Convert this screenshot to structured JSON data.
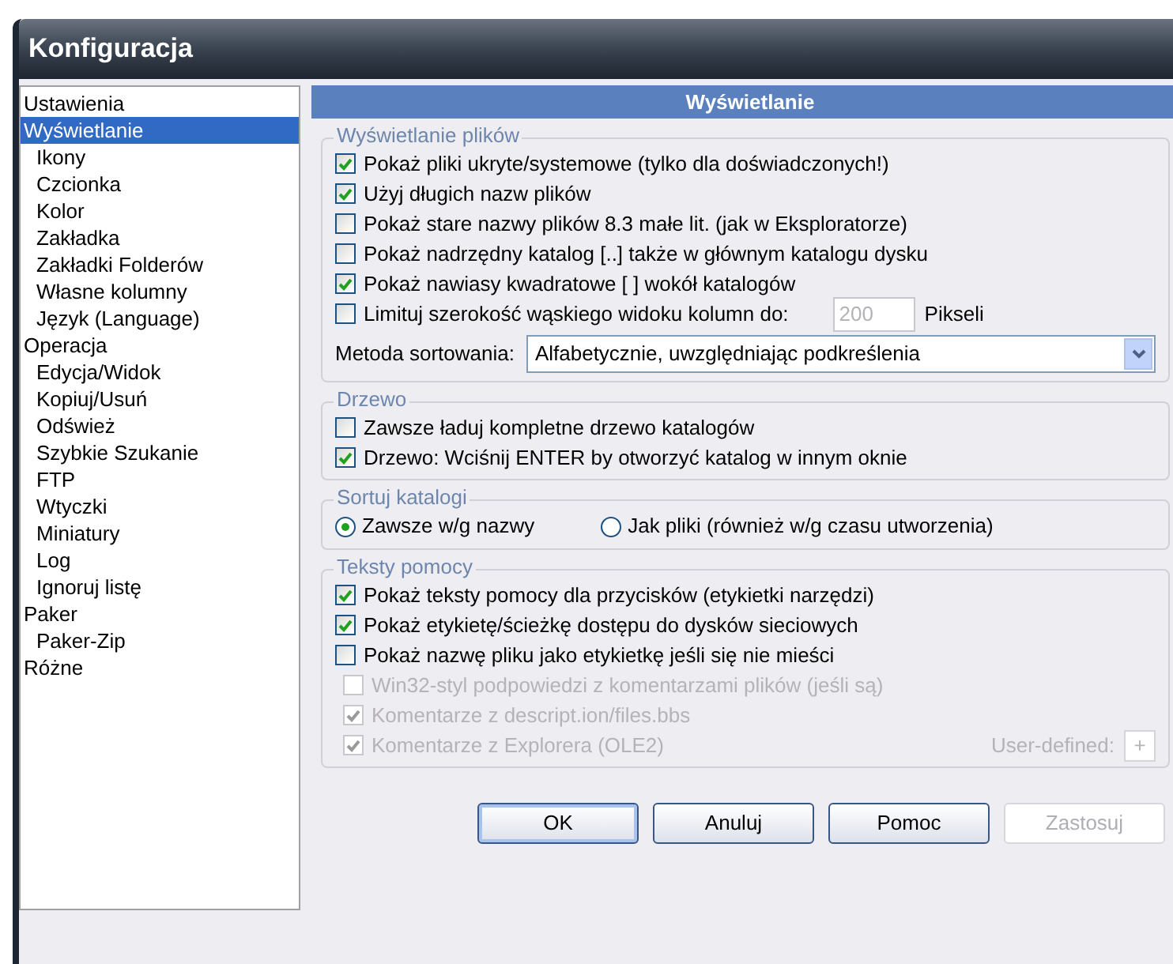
{
  "window": {
    "title": "Konfiguracja"
  },
  "sidebar": {
    "items": [
      {
        "label": "Ustawienia",
        "selected": false
      },
      {
        "label": "Wyświetlanie",
        "selected": true,
        "children": [
          {
            "label": "Ikony",
            "selected": false
          },
          {
            "label": "Czcionka",
            "selected": false
          },
          {
            "label": "Kolor",
            "selected": false
          },
          {
            "label": "Zakładka",
            "selected": false
          },
          {
            "label": "Zakładki Folderów",
            "selected": false
          },
          {
            "label": "Własne kolumny",
            "selected": false
          },
          {
            "label": "Język (Language)",
            "selected": false
          }
        ]
      },
      {
        "label": "Operacja",
        "selected": false,
        "children": [
          {
            "label": "Edycja/Widok",
            "selected": false
          },
          {
            "label": "Kopiuj/Usuń",
            "selected": false
          },
          {
            "label": "Odśwież",
            "selected": false
          },
          {
            "label": "Szybkie Szukanie",
            "selected": false
          },
          {
            "label": "FTP",
            "selected": false
          },
          {
            "label": "Wtyczki",
            "selected": false
          },
          {
            "label": "Miniatury",
            "selected": false
          },
          {
            "label": "Log",
            "selected": false
          },
          {
            "label": "Ignoruj listę",
            "selected": false
          }
        ]
      },
      {
        "label": "Paker",
        "selected": false,
        "children": [
          {
            "label": "Paker-Zip",
            "selected": false
          }
        ]
      },
      {
        "label": "Różne",
        "selected": false
      }
    ]
  },
  "panel_title": "Wyświetlanie",
  "groups": [
    {
      "title": "Wyświetlanie plików",
      "rows": [
        {
          "kind": "checkbox",
          "label": "Pokaż pliki ukryte/systemowe (tylko dla doświadczonych!)",
          "checked": true,
          "disabled": false
        },
        {
          "kind": "checkbox",
          "label": "Użyj długich nazw plików",
          "checked": true,
          "disabled": false
        },
        {
          "kind": "checkbox",
          "label": "Pokaż stare nazwy plików 8.3 małe lit. (jak w Eksploratorze)",
          "checked": false,
          "disabled": false
        },
        {
          "kind": "checkbox",
          "label": "Pokaż nadrzędny katalog [..] także w głównym katalogu dysku",
          "checked": false,
          "disabled": false
        },
        {
          "kind": "checkbox",
          "label": "Pokaż nawiasy kwadratowe [ ] wokół katalogów",
          "checked": true,
          "disabled": false
        },
        {
          "kind": "checkbox_input",
          "label": "Limituj szerokość wąskiego widoku kolumn do:",
          "checked": false,
          "disabled": false,
          "value": "200",
          "unit": "Pikseli"
        },
        {
          "kind": "dropdown",
          "label": "Metoda sortowania:",
          "value": "Alfabetycznie, uwzględniając podkreślenia"
        }
      ]
    },
    {
      "title": "Drzewo",
      "rows": [
        {
          "kind": "checkbox",
          "label": "Zawsze ładuj kompletne drzewo katalogów",
          "checked": false,
          "disabled": false
        },
        {
          "kind": "checkbox",
          "label": "Drzewo: Wciśnij ENTER by otworzyć katalog w innym oknie",
          "checked": true,
          "disabled": false
        }
      ]
    },
    {
      "title": "Sortuj katalogi",
      "rows": [
        {
          "kind": "radios",
          "options": [
            {
              "label": "Zawsze w/g nazwy",
              "selected": true
            },
            {
              "label": "Jak pliki (również w/g czasu utworzenia)",
              "selected": false
            }
          ]
        }
      ]
    },
    {
      "title": "Teksty pomocy",
      "rows": [
        {
          "kind": "checkbox",
          "label": "Pokaż teksty pomocy dla przycisków (etykietki narzędzi)",
          "checked": true,
          "disabled": false
        },
        {
          "kind": "checkbox",
          "label": "Pokaż etykietę/ścieżkę dostępu do dysków sieciowych",
          "checked": true,
          "disabled": false
        },
        {
          "kind": "checkbox",
          "label": "Pokaż nazwę pliku jako etykietkę jeśli się nie mieści",
          "checked": false,
          "disabled": false
        },
        {
          "kind": "sub_checkbox",
          "label": "Win32-styl podpowiedzi z komentarzami plików (jeśli są)",
          "checked": false,
          "disabled": true
        },
        {
          "kind": "sub_checkbox",
          "label": "Komentarze z descript.ion/files.bbs",
          "checked": true,
          "disabled": true
        },
        {
          "kind": "sub_checkbox_button",
          "label": "Komentarze z Explorera (OLE2)",
          "checked": true,
          "disabled": true,
          "extra_label": "User-defined:",
          "button": "+"
        }
      ]
    }
  ],
  "buttons": [
    {
      "label": "OK",
      "default": true,
      "disabled": false
    },
    {
      "label": "Anuluj",
      "default": false,
      "disabled": false
    },
    {
      "label": "Pomoc",
      "default": false,
      "disabled": false
    },
    {
      "label": "Zastosuj",
      "default": false,
      "disabled": true
    }
  ]
}
